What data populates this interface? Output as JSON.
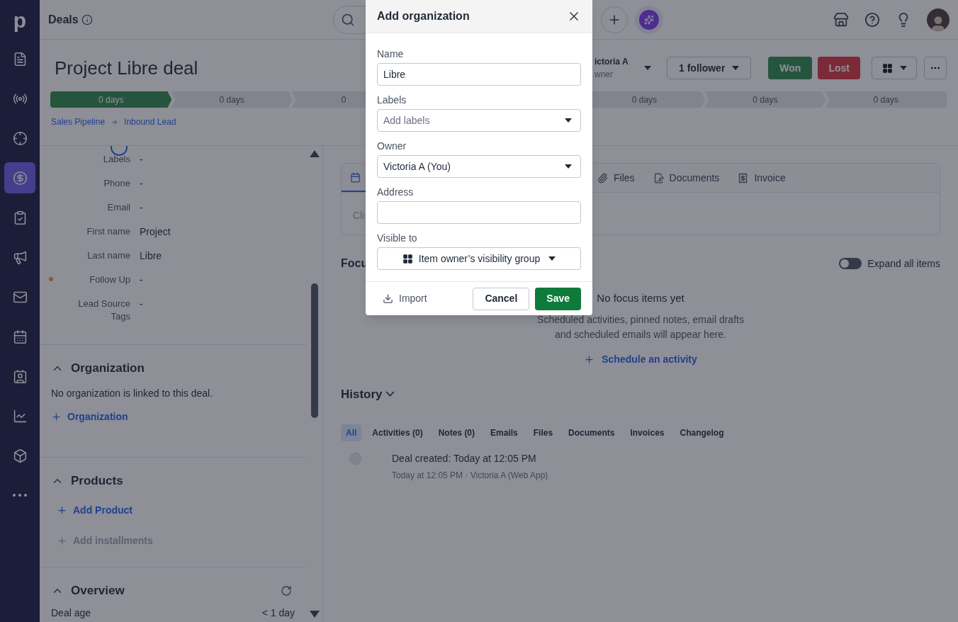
{
  "sidebar": {
    "logo": "p",
    "items": [
      {
        "selected": false
      },
      {
        "selected": false
      },
      {
        "selected": false
      },
      {
        "selected": true
      },
      {
        "selected": false
      },
      {
        "selected": false
      },
      {
        "selected": false
      },
      {
        "selected": false
      },
      {
        "selected": false
      },
      {
        "selected": false
      },
      {
        "selected": false
      },
      {
        "selected": false
      }
    ]
  },
  "header": {
    "title": "Deals"
  },
  "deal": {
    "title": "Project Libre deal",
    "owner_name": "ictoria A",
    "owner_role": "wner",
    "followers": "1 follower",
    "won": "Won",
    "lost": "Lost",
    "stages": [
      {
        "label": "0 days",
        "done": true,
        "kind": "full"
      },
      {
        "label": "0 days",
        "done": false,
        "kind": "full"
      },
      {
        "label": "0",
        "done": false,
        "kind": "clipped"
      },
      {
        "label": "0 days",
        "done": false,
        "kind": "full"
      },
      {
        "label": "0 days",
        "done": false,
        "kind": "full"
      },
      {
        "label": "0 days",
        "done": false,
        "kind": "full"
      }
    ],
    "breadcrumb": [
      "Sales Pipeline",
      "Inbound Lead"
    ]
  },
  "details": {
    "fields": [
      {
        "label": "Labels",
        "value": "-",
        "flag": false
      },
      {
        "label": "Phone",
        "value": "-",
        "flag": false
      },
      {
        "label": "Email",
        "value": "-",
        "flag": false
      },
      {
        "label": "First name",
        "value": "Project",
        "flag": false
      },
      {
        "label": "Last name",
        "value": "Libre",
        "flag": false
      },
      {
        "label": "Follow Up",
        "value": "-",
        "flag": true
      },
      {
        "label": "Lead Source Tags",
        "value": "-",
        "flag": false
      }
    ],
    "organization": {
      "title": "Organization",
      "text": "No organization is linked to this deal.",
      "link": "Organization"
    },
    "products": {
      "title": "Products",
      "add": "Add Product",
      "installments": "Add installments"
    },
    "overview": {
      "title": "Overview",
      "row_label": "Deal age",
      "row_value": "< 1 day"
    }
  },
  "main": {
    "tabs": [
      {
        "selected": true
      },
      {
        "label": "Files",
        "selected": false
      },
      {
        "label": "Documents",
        "selected": false
      },
      {
        "label": "Invoice",
        "selected": false
      }
    ],
    "composer_hint": "Cli",
    "focus": {
      "title": "Focu",
      "expand_label": "Expand all items",
      "expand_on": false,
      "empty_title": "No focus items yet",
      "empty_text": "Scheduled activities, pinned notes, email drafts and scheduled emails will appear here.",
      "schedule": "Schedule an activity"
    },
    "history": {
      "title": "History",
      "filters": [
        {
          "label": "All",
          "selected": true
        },
        {
          "label": "Activities (0)",
          "selected": false
        },
        {
          "label": "Notes (0)",
          "selected": false
        },
        {
          "label": "Emails",
          "selected": false
        },
        {
          "label": "Files",
          "selected": false
        },
        {
          "label": "Documents",
          "selected": false
        },
        {
          "label": "Invoices",
          "selected": false
        },
        {
          "label": "Changelog",
          "selected": false
        }
      ],
      "entries": [
        {
          "title": "Deal created: Today at 12:05 PM",
          "meta": "Today at 12:05 PM · Victoria A (Web App)"
        }
      ]
    }
  },
  "modal": {
    "title": "Add organization",
    "fields": [
      {
        "label": "Name",
        "kind": "text",
        "value": "Libre"
      },
      {
        "label": "Labels",
        "kind": "select",
        "placeholder": "Add labels"
      },
      {
        "label": "Owner",
        "kind": "select",
        "value": "Victoria A (You)"
      },
      {
        "label": "Address",
        "kind": "text"
      },
      {
        "label": "Visible to",
        "kind": "visibility",
        "value": "Item owner’s visibility group"
      }
    ],
    "import": "Import",
    "cancel": "Cancel",
    "save": "Save"
  }
}
